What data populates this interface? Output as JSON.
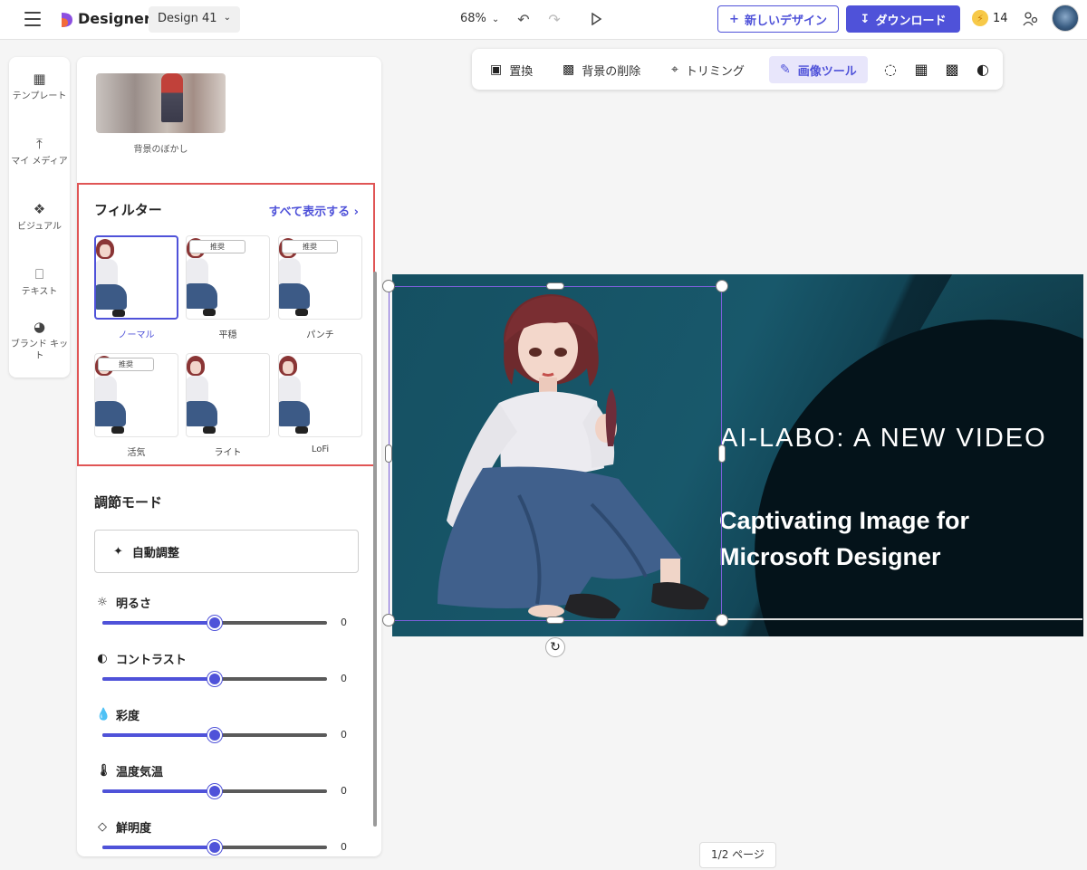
{
  "header": {
    "brand": "Designer",
    "design_name": "Design 41",
    "zoom": "68%",
    "new_design_label": "新しいデザイン",
    "download_label": "ダウンロード",
    "credits": "14",
    "accent_color": "#4f52d9"
  },
  "rail": {
    "items": [
      {
        "label": "テンプレート",
        "icon": "template-icon"
      },
      {
        "label": "マイ メディア",
        "icon": "upload-icon"
      },
      {
        "label": "ビジュアル",
        "icon": "visuals-icon"
      },
      {
        "label": "テキスト",
        "icon": "text-icon"
      },
      {
        "label": "ブランド キット",
        "icon": "palette-icon"
      }
    ]
  },
  "panel": {
    "blur_label": "背景のぼかし",
    "filters_title": "フィルター",
    "see_all": "すべて表示する",
    "filters": [
      {
        "label": "ノーマル",
        "tag": "",
        "selected": true
      },
      {
        "label": "平穏",
        "tag": "推奨",
        "selected": false
      },
      {
        "label": "パンチ",
        "tag": "推奨",
        "selected": false
      },
      {
        "label": "活気",
        "tag": "推奨",
        "selected": false
      },
      {
        "label": "ライト",
        "tag": "",
        "selected": false
      },
      {
        "label": "LoFi",
        "tag": "",
        "selected": false
      }
    ],
    "adjust_title": "調節モード",
    "auto_adjust": "自動調整",
    "adjustments": [
      {
        "label": "明るさ",
        "icon": "brightness-icon",
        "value": "0",
        "level": 0.5
      },
      {
        "label": "コントラスト",
        "icon": "contrast-icon",
        "value": "0",
        "level": 0.5
      },
      {
        "label": "彩度",
        "icon": "saturation-drop-icon",
        "value": "0",
        "level": 0.5
      },
      {
        "label": "温度気温",
        "icon": "thermometer-icon",
        "value": "0",
        "level": 0.5
      },
      {
        "label": "鮮明度",
        "icon": "diamond-icon",
        "value": "0",
        "level": 0.5
      }
    ]
  },
  "toolbar": {
    "replace": "置換",
    "remove_bg": "背景の削除",
    "crop": "トリミング",
    "image_tools": "画像ツール"
  },
  "canvas": {
    "headline": "AI-LABO: A NEW VIDEO",
    "subhead": "Captivating Image for Microsoft Designer"
  },
  "pager": "1/2 ページ"
}
